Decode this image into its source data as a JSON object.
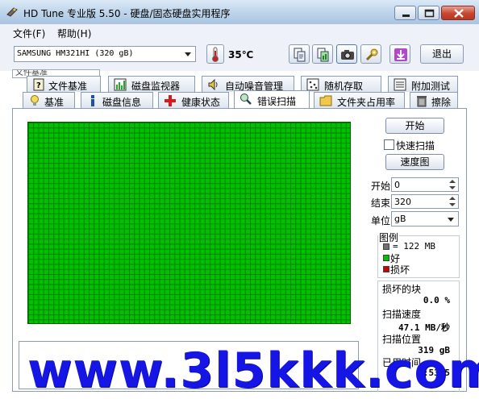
{
  "window": {
    "title": "HD Tune 专业版 5.50 - 硬盘/固态硬盘实用程序",
    "icon": "hdtune-icon"
  },
  "menu": [
    "文件(F)",
    "帮助(H)"
  ],
  "toolbar": {
    "drive": "SAMSUNG HM321HI (320 gB)",
    "temperature": "35℃",
    "exit_label": "退出",
    "icons": [
      "copy-text-icon",
      "copy-screenshot-icon",
      "camera-icon",
      "options-icon",
      "save-download-icon"
    ]
  },
  "strip_text": "文件基准",
  "tabs_row1": [
    {
      "label": "文件基准",
      "icon": "file-benchmark-icon"
    },
    {
      "label": "磁盘监视器",
      "icon": "disk-monitor-icon"
    },
    {
      "label": "自动噪音管理",
      "icon": "speaker-icon"
    },
    {
      "label": "随机存取",
      "icon": "random-access-icon"
    },
    {
      "label": "附加测试",
      "icon": "extra-tests-icon"
    }
  ],
  "tabs_row2": [
    {
      "label": "基准",
      "icon": "benchmark-icon"
    },
    {
      "label": "磁盘信息",
      "icon": "info-icon"
    },
    {
      "label": "健康状态",
      "icon": "health-cross-icon"
    },
    {
      "label": "错误扫描",
      "icon": "magnifier-icon",
      "active": true
    },
    {
      "label": "文件夹占用率",
      "icon": "folder-icon"
    },
    {
      "label": "擦除",
      "icon": "trash-icon"
    }
  ],
  "scan": {
    "start_label": "开始",
    "quick_scan_label": "快速扫描",
    "quick_scan_checked": false,
    "speed_map_label": "速度图",
    "start_field_label": "开始",
    "start_value": "0",
    "end_field_label": "结束",
    "end_value": "320",
    "unit_label": "单位",
    "unit_value": "gB",
    "grid_color_good": "#00c000",
    "grid_all_good": true
  },
  "legend": {
    "title": "图例",
    "block_size": "= 122 MB",
    "good_label": "好",
    "bad_label": "损坏",
    "good_color": "#00c000",
    "bad_color": "#d00000",
    "block_color": "#707070"
  },
  "stats": {
    "damaged_label": "损坏的块",
    "damaged_value": "0.0 %",
    "speed_label": "扫描速度",
    "speed_value": "47.1 MB/秒",
    "position_label": "扫描位置",
    "position_value": "319 gB",
    "elapsed_label": "已用时间",
    "elapsed_value": "1:53:5"
  },
  "watermark": "www.3l5kkk.com"
}
